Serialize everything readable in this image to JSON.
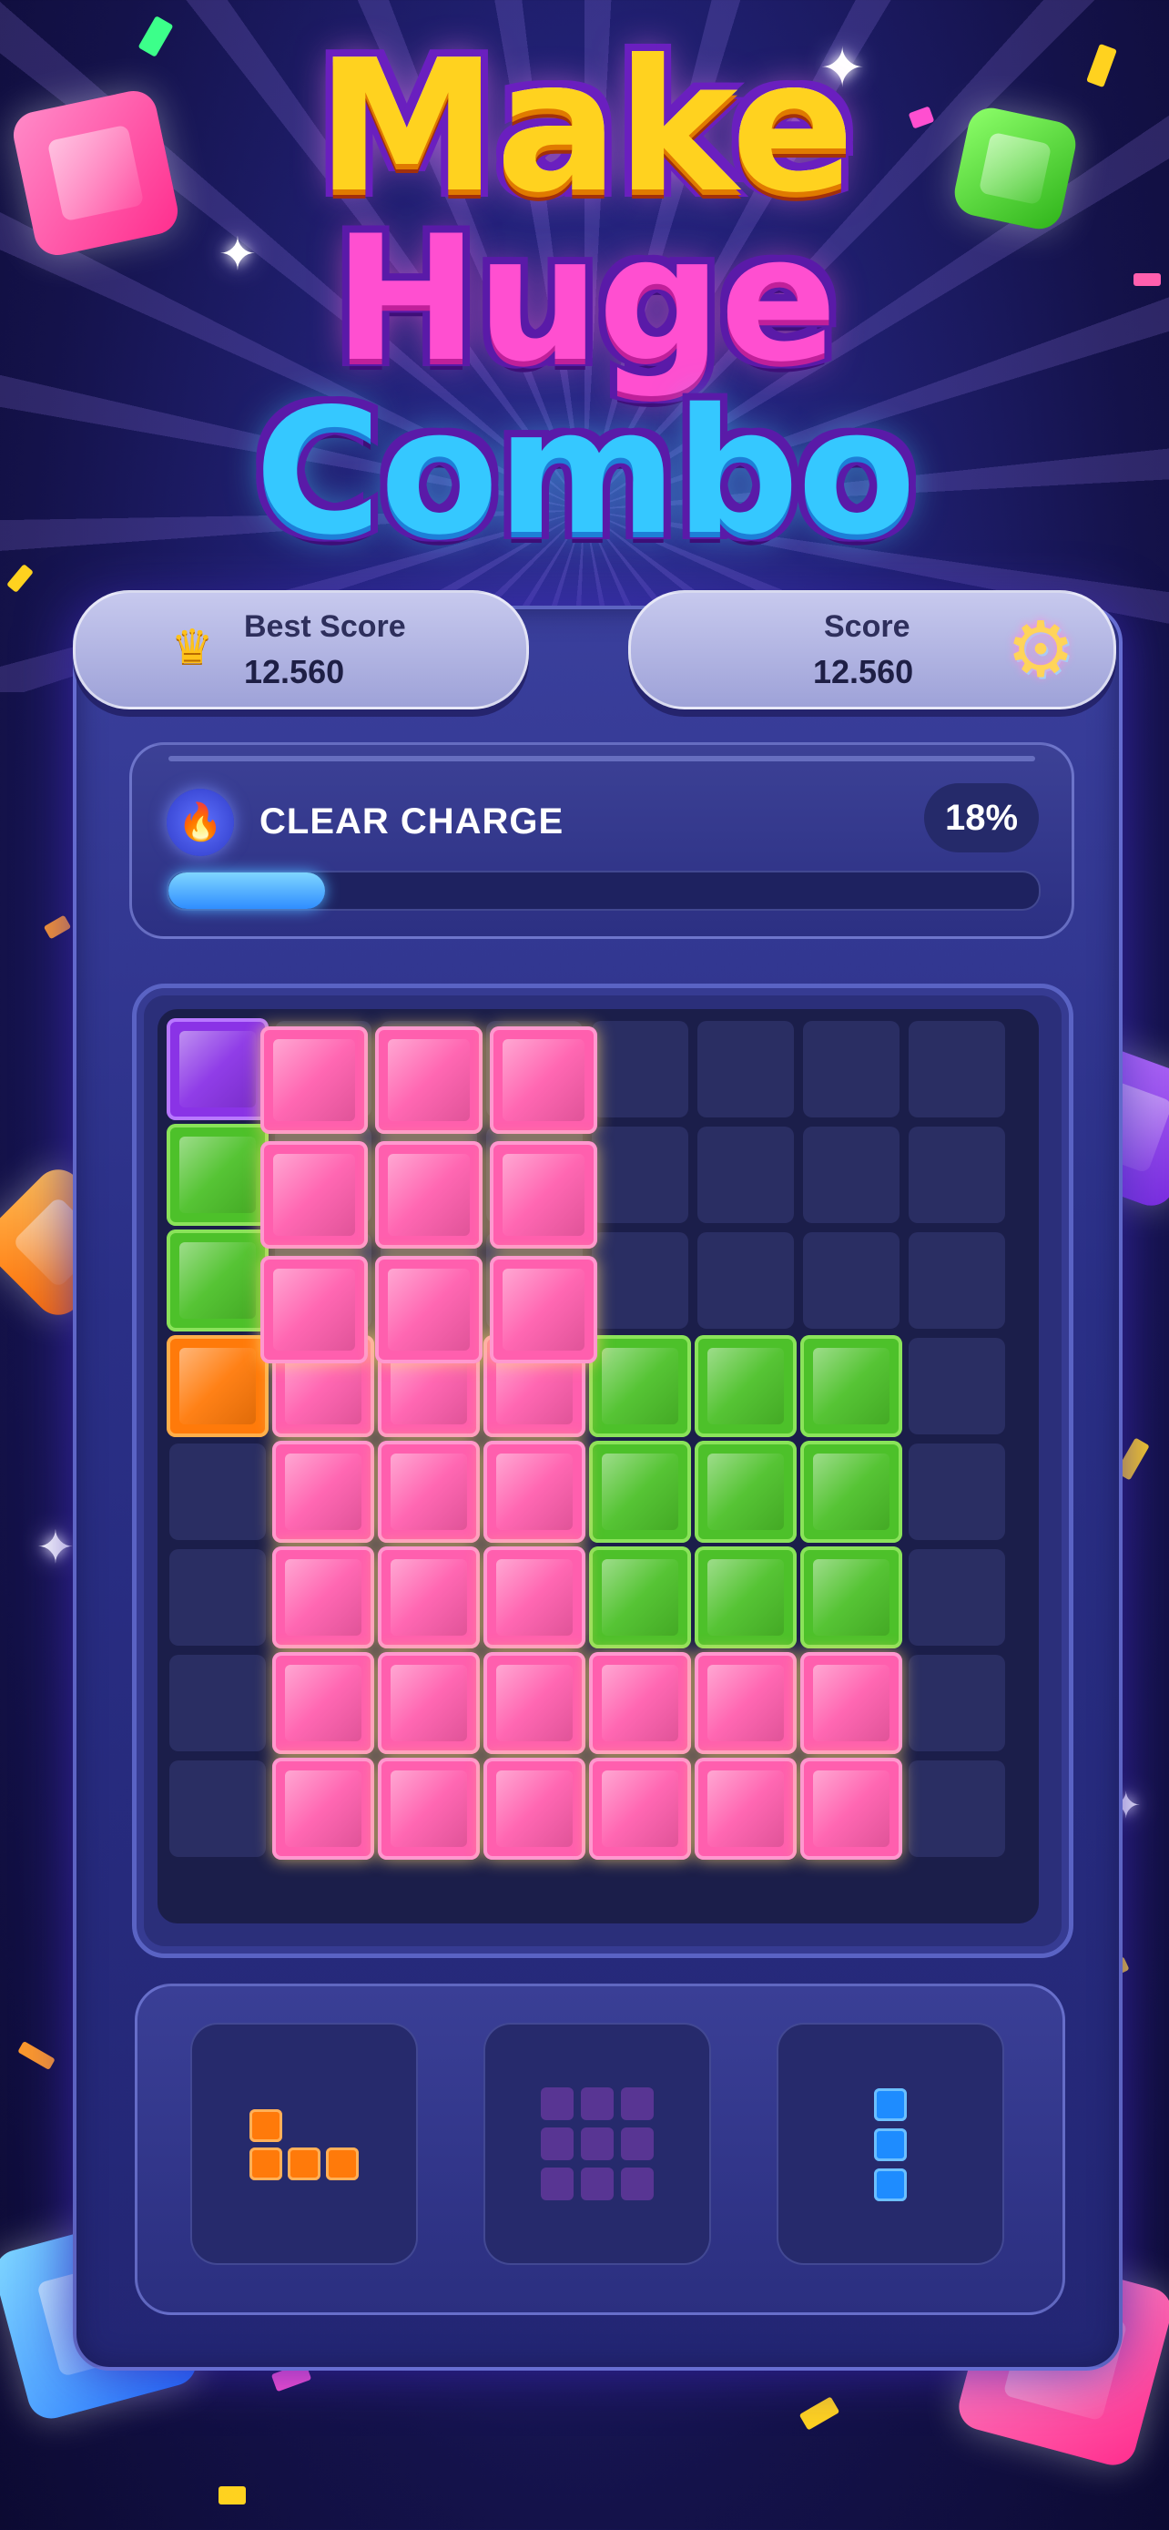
{
  "title": {
    "line1": "Make",
    "line2_part1": "Huge",
    "line2_part2": "Combo"
  },
  "scores": {
    "best_label": "Best Score",
    "best_value": "12.560",
    "current_label": "Score",
    "current_value": "12.560"
  },
  "clear_charge": {
    "label": "CLEAR CHARGE",
    "percent_text": "18%",
    "progress": 0.18
  },
  "board": {
    "columns": 8,
    "rows": 8,
    "filled": [
      {
        "row": 0,
        "col": 0,
        "color": "purple"
      },
      {
        "row": 1,
        "col": 0,
        "color": "green"
      },
      {
        "row": 2,
        "col": 0,
        "color": "green"
      },
      {
        "row": 3,
        "col": 0,
        "color": "orange"
      },
      {
        "row": 3,
        "col": 4,
        "color": "green"
      },
      {
        "row": 3,
        "col": 5,
        "color": "green"
      },
      {
        "row": 3,
        "col": 6,
        "color": "green"
      },
      {
        "row": 4,
        "col": 4,
        "color": "green"
      },
      {
        "row": 4,
        "col": 5,
        "color": "green"
      },
      {
        "row": 4,
        "col": 6,
        "color": "green"
      },
      {
        "row": 5,
        "col": 4,
        "color": "green"
      },
      {
        "row": 5,
        "col": 5,
        "color": "green"
      },
      {
        "row": 5,
        "col": 6,
        "color": "green"
      },
      {
        "row": 3,
        "col": 1,
        "color": "pink"
      },
      {
        "row": 3,
        "col": 2,
        "color": "pink"
      },
      {
        "row": 3,
        "col": 3,
        "color": "pink"
      },
      {
        "row": 4,
        "col": 1,
        "color": "pink"
      },
      {
        "row": 4,
        "col": 2,
        "color": "pink"
      },
      {
        "row": 4,
        "col": 3,
        "color": "pink"
      },
      {
        "row": 5,
        "col": 1,
        "color": "pink"
      },
      {
        "row": 5,
        "col": 2,
        "color": "pink"
      },
      {
        "row": 5,
        "col": 3,
        "color": "pink"
      },
      {
        "row": 6,
        "col": 1,
        "color": "pink"
      },
      {
        "row": 6,
        "col": 2,
        "color": "pink"
      },
      {
        "row": 6,
        "col": 3,
        "color": "pink"
      },
      {
        "row": 6,
        "col": 4,
        "color": "pink"
      },
      {
        "row": 6,
        "col": 5,
        "color": "pink"
      },
      {
        "row": 6,
        "col": 6,
        "color": "pink"
      },
      {
        "row": 7,
        "col": 1,
        "color": "pink"
      },
      {
        "row": 7,
        "col": 2,
        "color": "pink"
      },
      {
        "row": 7,
        "col": 3,
        "color": "pink"
      },
      {
        "row": 7,
        "col": 4,
        "color": "pink"
      },
      {
        "row": 7,
        "col": 5,
        "color": "pink"
      },
      {
        "row": 7,
        "col": 6,
        "color": "pink"
      }
    ],
    "dragging_piece": {
      "color": "pink",
      "shape": "3x3 square"
    }
  },
  "tray": {
    "pieces": [
      {
        "shape": "L-shape",
        "color": "orange",
        "state": "available"
      },
      {
        "shape": "3x3 square",
        "color": "purple",
        "state": "placed"
      },
      {
        "shape": "vertical 3-line",
        "color": "blue",
        "state": "available"
      }
    ]
  },
  "colors": {
    "pink": "#ff5fae",
    "green": "#4dc12a",
    "orange": "#ff7a0a",
    "purple": "#8a33e6",
    "blue": "#1e8cff",
    "progress": "#2f8dff"
  },
  "icons": {
    "best_score": "crown-icon",
    "settings": "gear-icon",
    "charge": "flame-icon"
  }
}
